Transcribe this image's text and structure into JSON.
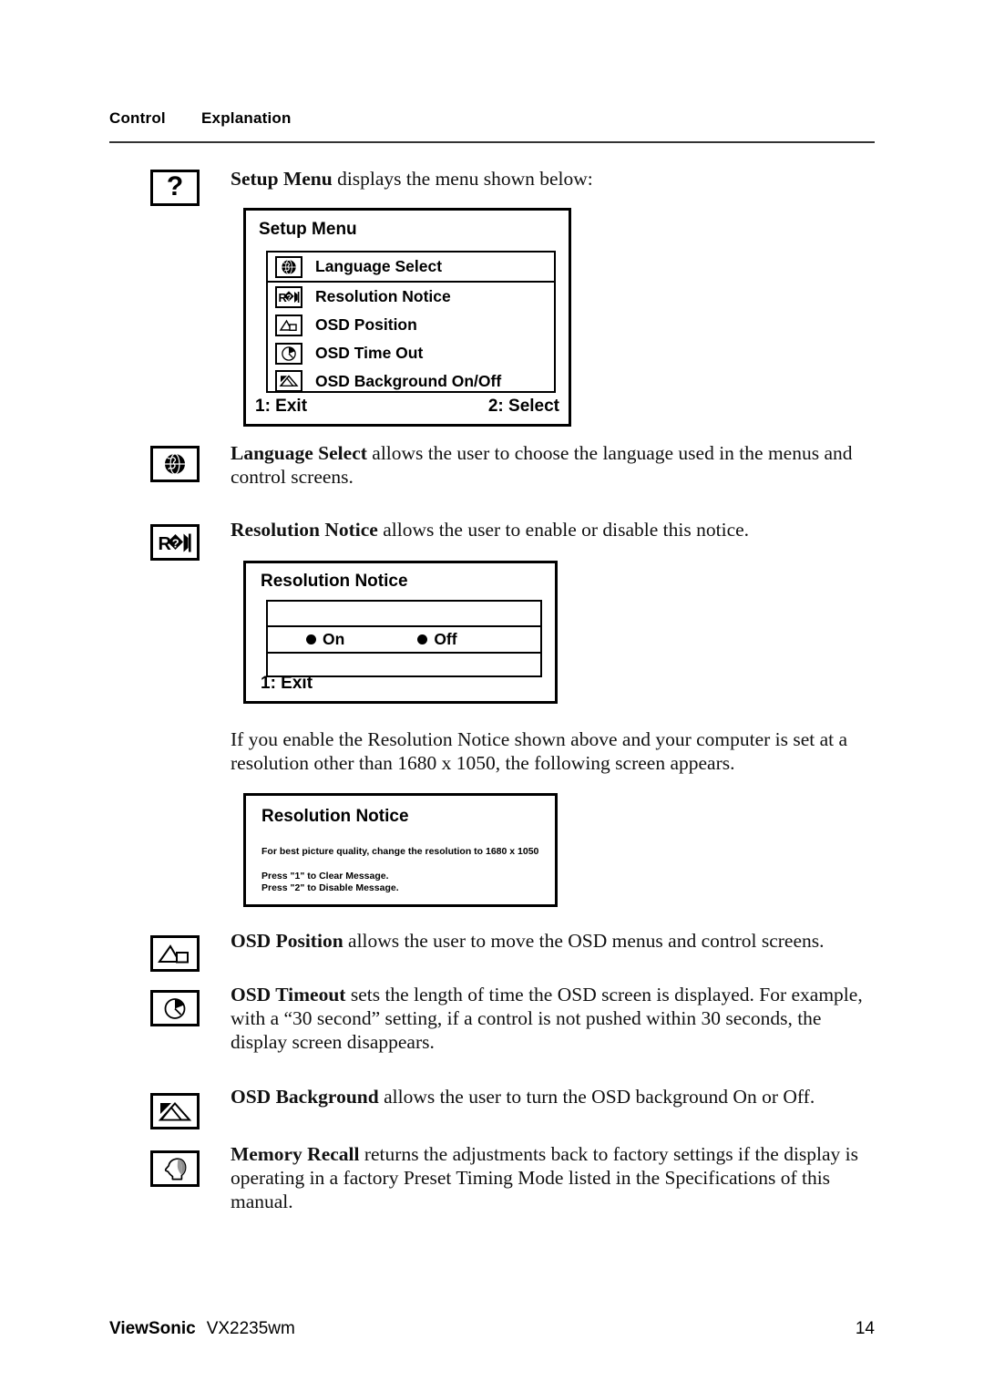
{
  "header": {
    "col_control": "Control",
    "col_explanation": "Explanation"
  },
  "rows": {
    "setup_menu": {
      "icon": "question-mark-icon",
      "icon_glyph": "?",
      "text_bold": "Setup Menu",
      "text_rest": " displays the menu shown below:"
    },
    "language_select": {
      "icon": "globe-icon",
      "text_bold": "Language Select",
      "text_rest": " allows the user to choose the language used in the menus and control screens."
    },
    "resolution_notice": {
      "icon": "resolution-notice-icon",
      "text_bold": "Resolution Notice",
      "text_rest": " allows the user to enable or disable this notice."
    },
    "resolution_para": {
      "text": "If you enable the Resolution Notice shown above and your computer is set at a resolution other than 1680 x 1050, the following screen appears."
    },
    "osd_position": {
      "icon": "osd-position-icon",
      "text_bold": "OSD Position",
      "text_rest": " allows the user to move the OSD menus and control screens."
    },
    "osd_timeout": {
      "icon": "osd-timeout-clock-icon",
      "text_bold": "OSD Timeout",
      "text_rest": " sets the length of time the OSD screen is displayed. For example, with a “30 second” setting, if a control is not pushed within 30 seconds, the display screen disappears."
    },
    "osd_background": {
      "icon": "osd-background-icon",
      "text_bold": "OSD Background",
      "text_rest": " allows the user to turn the OSD background On or Off."
    },
    "memory_recall": {
      "icon": "memory-recall-head-icon",
      "text_bold": "Memory Recall",
      "text_rest": " returns the adjustments back to factory settings if the display is operating in a factory Preset Timing Mode listed in the Specifications of this manual."
    }
  },
  "setup_menu_screen": {
    "title": "Setup Menu",
    "items": [
      {
        "icon": "globe-icon",
        "label": "Language Select"
      },
      {
        "icon": "resolution-notice-icon",
        "label": "Resolution Notice"
      },
      {
        "icon": "osd-position-icon",
        "label": "OSD Position"
      },
      {
        "icon": "osd-timeout-clock-icon",
        "label": "OSD Time Out"
      },
      {
        "icon": "osd-background-icon",
        "label": "OSD Background On/Off"
      }
    ],
    "footer_left": "1: Exit",
    "footer_right": "2: Select"
  },
  "resolution_notice_screen": {
    "title": "Resolution Notice",
    "option_on": "On",
    "option_off": "Off",
    "footer_left": "1: Exit"
  },
  "resolution_notice_message_screen": {
    "title": "Resolution Notice",
    "line1": "For best picture quality, change the resolution to 1680 x 1050",
    "line2": "Press \"1\" to Clear Message.",
    "line3": "Press \"2\" to Disable Message."
  },
  "footer": {
    "brand": "ViewSonic",
    "model": "VX2235wm",
    "page_number": "14"
  },
  "colors": {
    "text": "#000000",
    "rule": "#333333",
    "background": "#ffffff"
  }
}
